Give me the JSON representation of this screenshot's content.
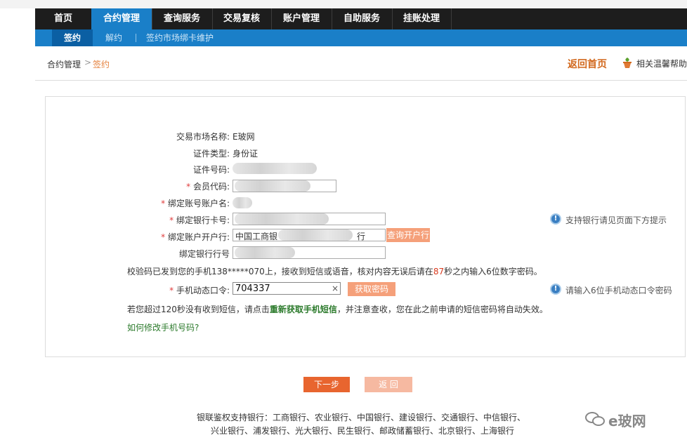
{
  "nav": {
    "items": [
      "首页",
      "合约管理",
      "查询服务",
      "交易复核",
      "账户管理",
      "自助服务",
      "挂账处理"
    ],
    "active_index": 1
  },
  "subnav": {
    "items": [
      "签约",
      "解约",
      "签约市场绑卡维护"
    ],
    "active_index": 0
  },
  "breadcrumb": {
    "parent": "合约管理",
    "separator": ">",
    "current": "签约"
  },
  "header_links": {
    "home": "返回首页",
    "help": "相关温馨帮助"
  },
  "form": {
    "market_label": "交易市场名称:",
    "market_value": "E玻网",
    "id_type_label": "证件类型:",
    "id_type_value": "身份证",
    "id_number_label": "证件号码:",
    "member_code_label": "会员代码:",
    "account_name_label": "绑定账号账户名:",
    "bank_card_label": "绑定银行卡号:",
    "bank_branch_label": "绑定账户开户行:",
    "bank_branch_value": "中国工商银",
    "bank_branch_suffix": "行",
    "bank_branch_button": "查询开户行",
    "bank_code_label": "绑定银行行号",
    "required_mark": "*",
    "otp_label": "手机动态口令:",
    "otp_value": "704337",
    "clear_symbol": "×",
    "otp_button": "获取密码"
  },
  "tips": {
    "bank_support": "支持银行请见页面下方提示",
    "otp_hint": "请输入6位手机动态口令密码",
    "icon_glyph": "!"
  },
  "notices": {
    "sms_prefix": "校验码已发到您的手机138*****070上，接收到短信或语音，核对内容无误后请在",
    "sms_seconds": "87",
    "sms_suffix": "秒之内输入6位数字密码。",
    "resend_prefix": "若您超过120秒没有收到短信，请点击",
    "resend_link": "重新获取手机短信",
    "resend_suffix": "，并注意查收，您在此之前申请的短信密码将自动失效。",
    "change_phone_link": "如何修改手机号码?"
  },
  "buttons": {
    "next": "下一步",
    "back": "返 回"
  },
  "footer": {
    "banks_line1": "银联鉴权支持银行：工商银行、农业银行、中国银行、建设银行、交通银行、中信银行、",
    "banks_line2": "兴业银行、浦发银行、光大银行、民生银行、邮政储蓄银行、北京银行、上海银行"
  },
  "watermark": "e玻网",
  "colors": {
    "nav_bg": "#1d1d1d",
    "accent_blue": "#1a7fc8",
    "orange": "#e8652f",
    "light_orange": "#f5a07a",
    "link_green": "#2b7a2b",
    "countdown_red": "#d93a1e"
  }
}
